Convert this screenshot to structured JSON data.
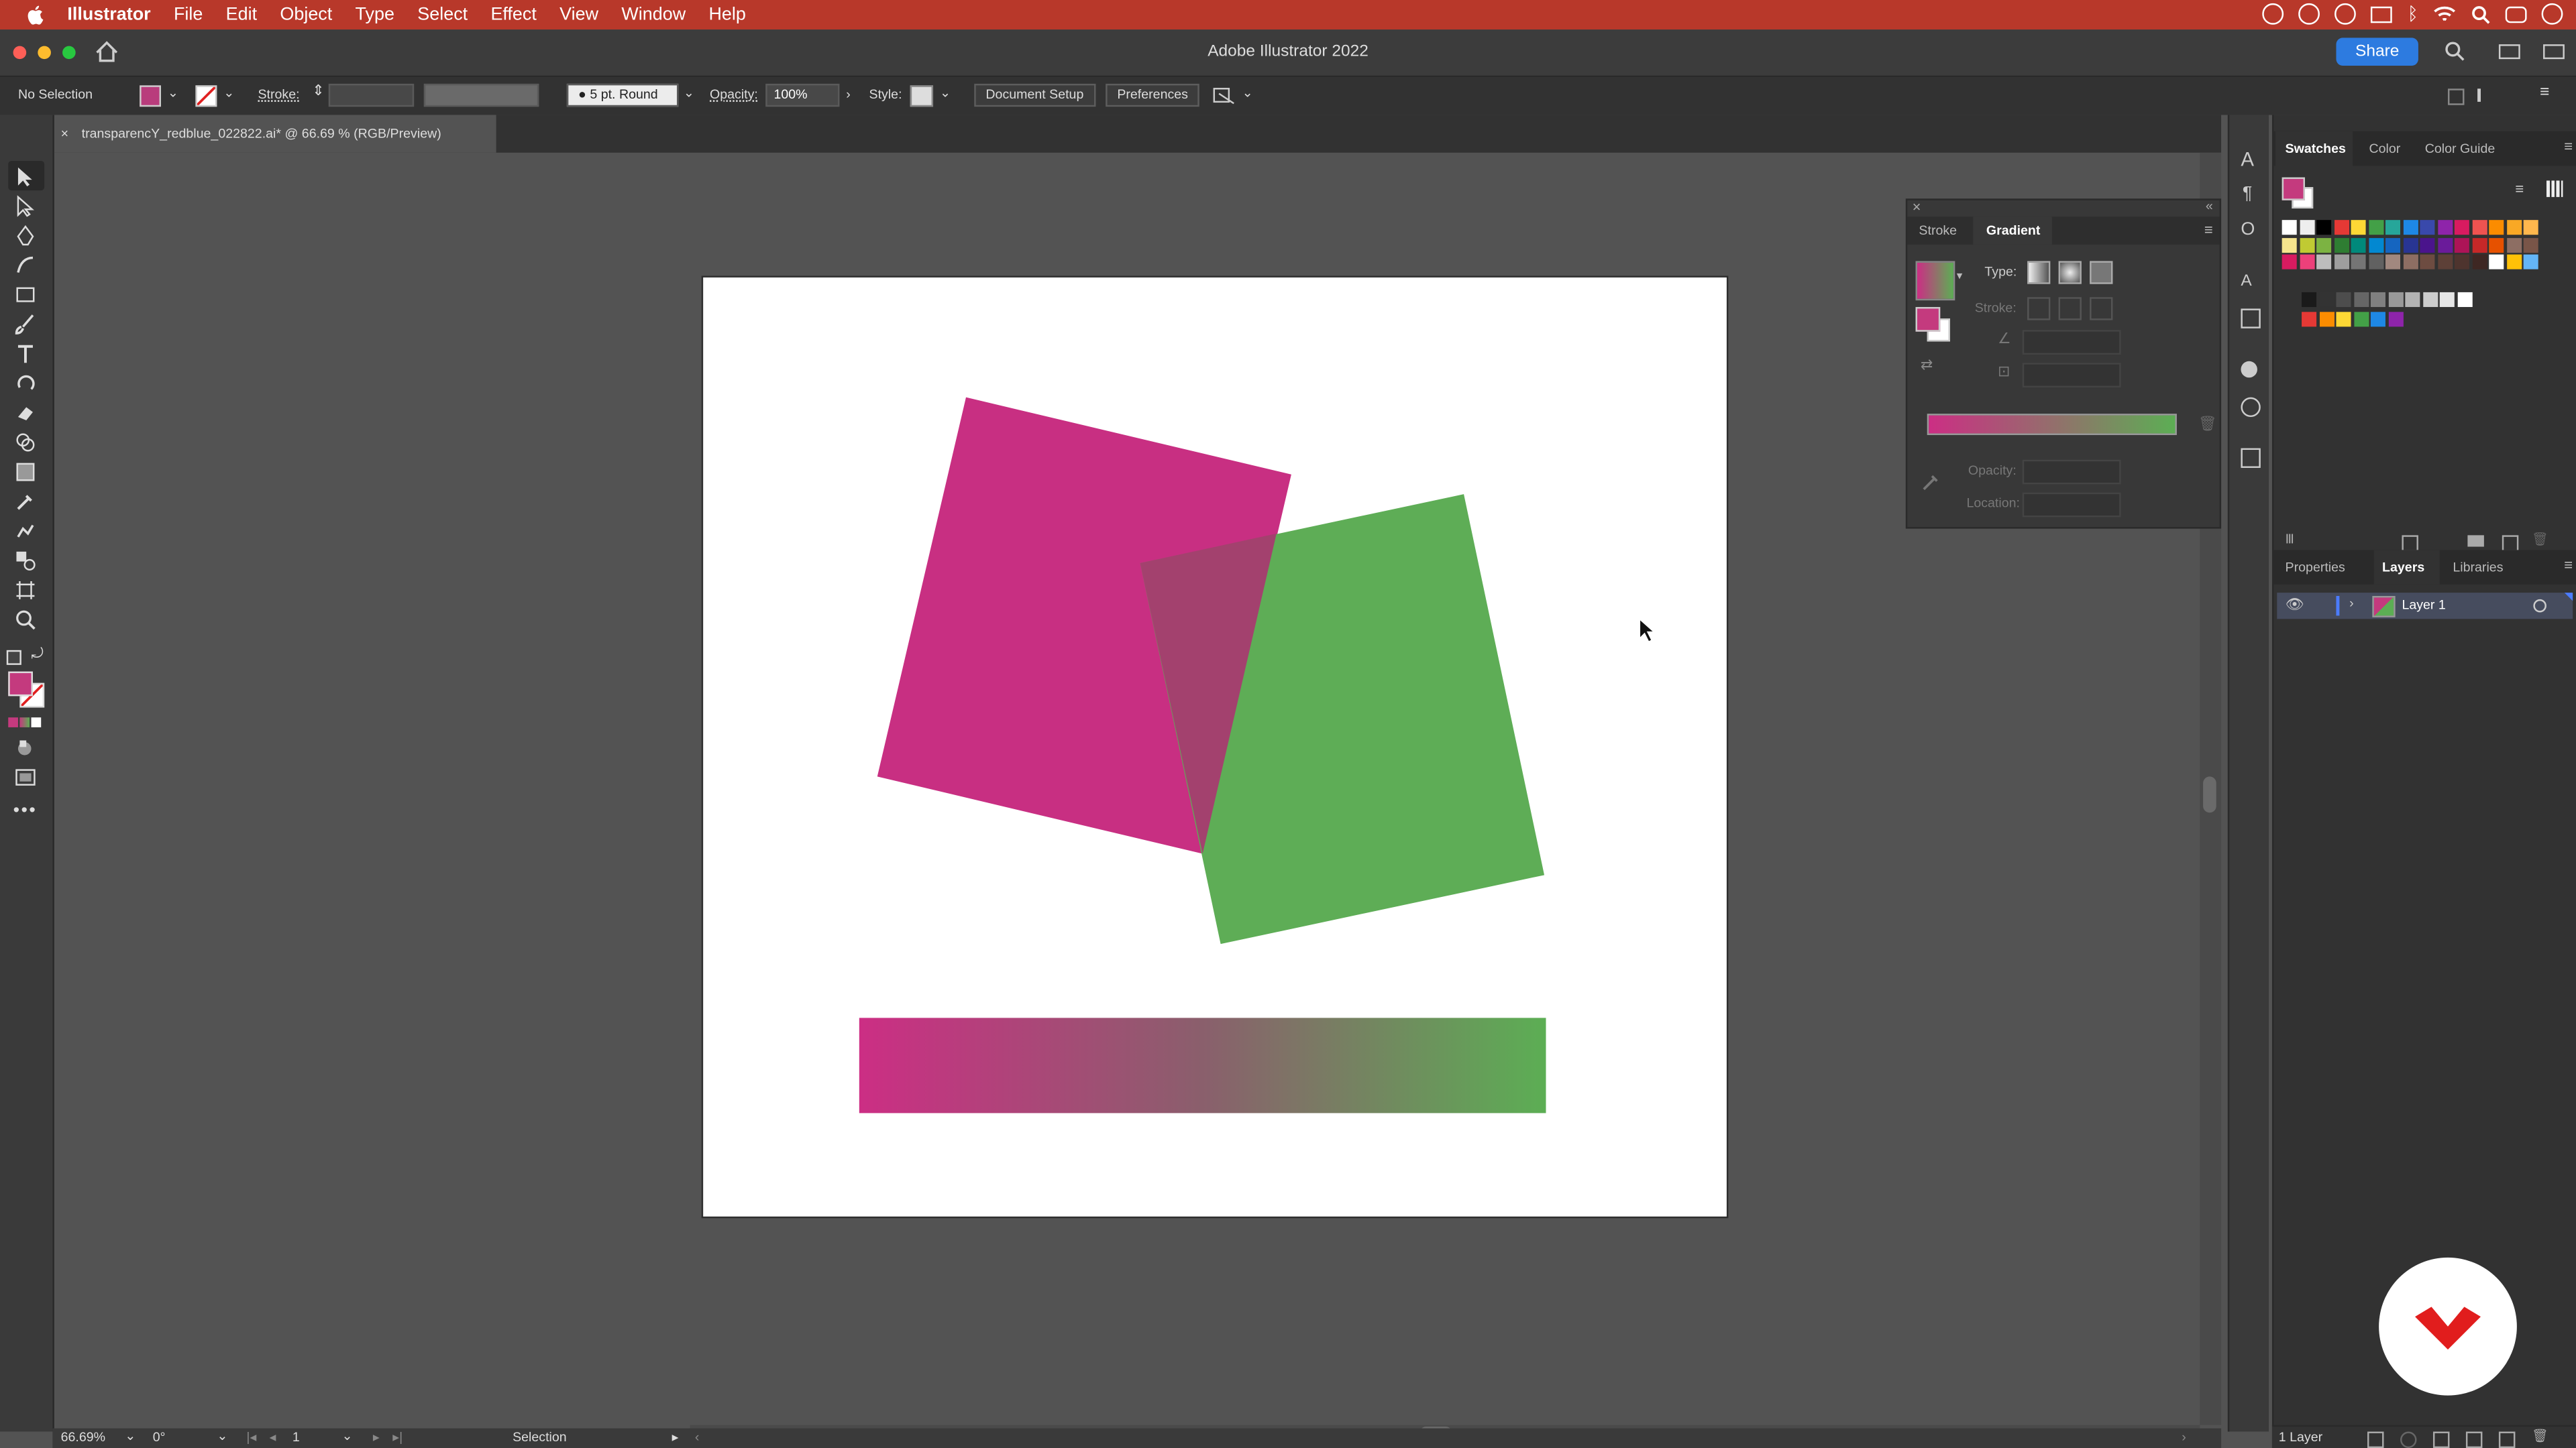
{
  "menubar": {
    "app_name": "Illustrator",
    "items": [
      "File",
      "Edit",
      "Object",
      "Type",
      "Select",
      "Effect",
      "View",
      "Window",
      "Help"
    ]
  },
  "titlebar": {
    "window_title": "Adobe Illustrator 2022",
    "share_label": "Share"
  },
  "controlbar": {
    "selection_status": "No Selection",
    "stroke_label": "Stroke:",
    "brush_label": "5 pt. Round",
    "opacity_label": "Opacity:",
    "opacity_value": "100%",
    "style_label": "Style:",
    "document_setup_label": "Document Setup",
    "preferences_label": "Preferences"
  },
  "document_tab": {
    "close_symbol": "×",
    "title": "transparencY_redblue_022822.ai* @ 66.69 % (RGB/Preview)"
  },
  "gradient_panel": {
    "tabs": [
      "Stroke",
      "Gradient"
    ],
    "active_tab": "Gradient",
    "type_label": "Type:",
    "stroke_label": "Stroke:",
    "opacity_label": "Opacity:",
    "location_label": "Location:",
    "gradient_start_color": "#cc2e84",
    "gradient_end_color": "#5cae54"
  },
  "right_panel": {
    "top_tabs": [
      "Swatches",
      "Color",
      "Color Guide"
    ],
    "top_active": "Swatches",
    "bottom_tabs": [
      "Properties",
      "Layers",
      "Libraries"
    ],
    "bottom_active": "Layers",
    "layer_name": "Layer 1",
    "layers_count": "1 Layer"
  },
  "statusbar": {
    "zoom": "66.69%",
    "rotation": "0°",
    "artboard_number": "1",
    "tool_name": "Selection"
  },
  "artwork": {
    "magenta_color": "#c82f82",
    "green_color": "#5ead56",
    "overlap_color": "#a3416e"
  },
  "colors": {
    "menubar_red": "#b8382a",
    "share_blue": "#2d7be0",
    "workspace_gray": "#535353"
  }
}
